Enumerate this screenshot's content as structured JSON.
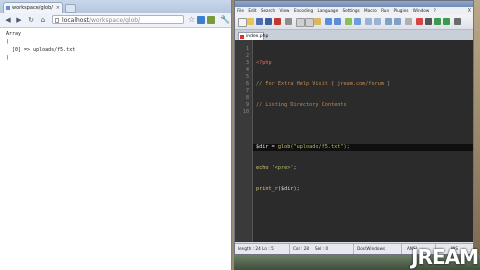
{
  "browser": {
    "tab_title": "workspace/glob/",
    "url_host": "localhost",
    "url_path": "/workspace/glob/",
    "output_lines": [
      "Array",
      "(",
      "[0] => uploads/f5.txt",
      ")"
    ]
  },
  "editor": {
    "menu": [
      "File",
      "Edit",
      "Search",
      "View",
      "Encoding",
      "Language",
      "Settings",
      "Macro",
      "Run",
      "Plugins",
      "Window",
      "?"
    ],
    "window_controls": "X",
    "tab_label": "index.php",
    "line_numbers": [
      "1",
      "2",
      "3",
      "4",
      "5",
      "6",
      "7",
      "8",
      "9",
      "10"
    ],
    "code": {
      "l1": "<?php",
      "l2": "// For Extra Help Visit { jream.com/forum }",
      "l3": "// Listing Directory Contents",
      "l5_var": "$dir",
      "l5_op": " = ",
      "l5_fn": "glob",
      "l5_arg": "(\"uploads/f5.txt\");",
      "l6_kw": "echo",
      "l6_str": " '<pre>'",
      "l6_end": ";",
      "l7_fn": "print_r",
      "l7_arg": "($dir);"
    },
    "status": {
      "length": "length : 24  Ln : 5",
      "col": "Col : 28",
      "sel": "Sel : 0",
      "eol": "Dos\\Windows",
      "encoding": "ANSI",
      "mode": "INS"
    }
  },
  "logo_text": "JREAM",
  "colors": {
    "editor_bg": "#2b2b2b",
    "tag": "#e06c5a",
    "comment": "#c18a54",
    "function": "#d9c97a",
    "string": "#a9c36b"
  }
}
